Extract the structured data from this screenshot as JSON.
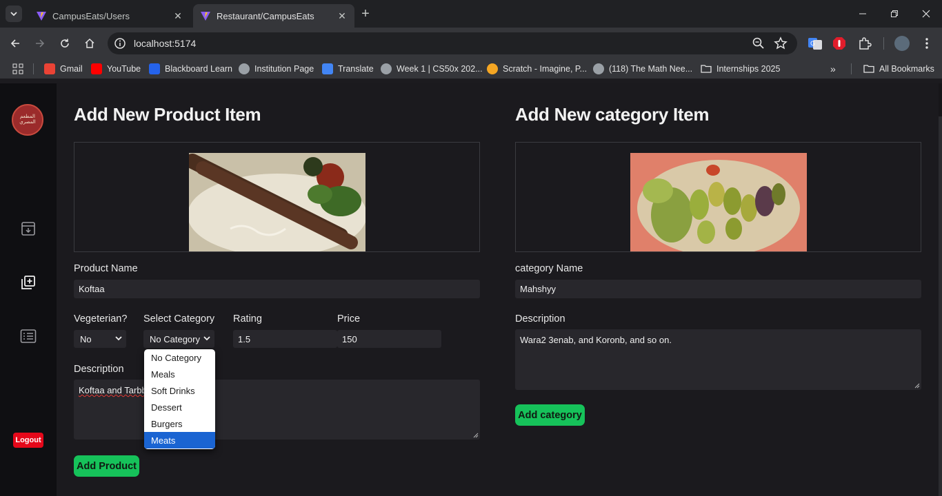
{
  "browser": {
    "tabs": [
      {
        "title": "CampusEats/Users",
        "active": false
      },
      {
        "title": "Restaurant/CampusEats",
        "active": true
      }
    ],
    "url": "localhost:5174",
    "bookmarks": [
      {
        "label": "Gmail",
        "icon": "gmail-icon",
        "color": "#ea4335"
      },
      {
        "label": "YouTube",
        "icon": "youtube-icon",
        "color": "#ff0000"
      },
      {
        "label": "Blackboard Learn",
        "icon": "blackboard-icon",
        "color": "#2563eb"
      },
      {
        "label": "Institution Page",
        "icon": "globe-icon",
        "color": "#9aa0a6"
      },
      {
        "label": "Translate",
        "icon": "translate-icon",
        "color": "#4285f4"
      },
      {
        "label": "Week 1 | CS50x 202...",
        "icon": "globe-icon",
        "color": "#9aa0a6"
      },
      {
        "label": "Scratch - Imagine, P...",
        "icon": "scratch-icon",
        "color": "#f5a623"
      },
      {
        "label": "(118) The Math Nee...",
        "icon": "globe-icon",
        "color": "#9aa0a6"
      },
      {
        "label": "Internships 2025",
        "icon": "folder-icon",
        "color": "#e3e3e3"
      }
    ],
    "all_bookmarks": "All Bookmarks"
  },
  "sidebar": {
    "logo_text": "المطعم المصري",
    "logout": "Logout"
  },
  "product": {
    "heading": "Add New Product Item",
    "name_label": "Product Name",
    "name_value": "Koftaa",
    "veg_label": "Vegeterian?",
    "veg_value": "No",
    "category_label": "Select Category",
    "category_value": "No Category",
    "rating_label": "Rating",
    "rating_value": "1.5",
    "price_label": "Price",
    "price_value": "150",
    "description_label": "Description",
    "description_value": "Koftaa and Tarbb",
    "submit": "Add Product",
    "category_options": [
      "No Category",
      "Meals",
      "Soft Drinks",
      "Dessert",
      "Burgers",
      "Meats"
    ],
    "highlighted_option": "Meats"
  },
  "category": {
    "heading": "Add New category Item",
    "name_label": "category Name",
    "name_value": "Mahshyy",
    "description_label": "Description",
    "description_value": "Wara2 3enab, and Koronb, and so on.",
    "submit": "Add category"
  }
}
